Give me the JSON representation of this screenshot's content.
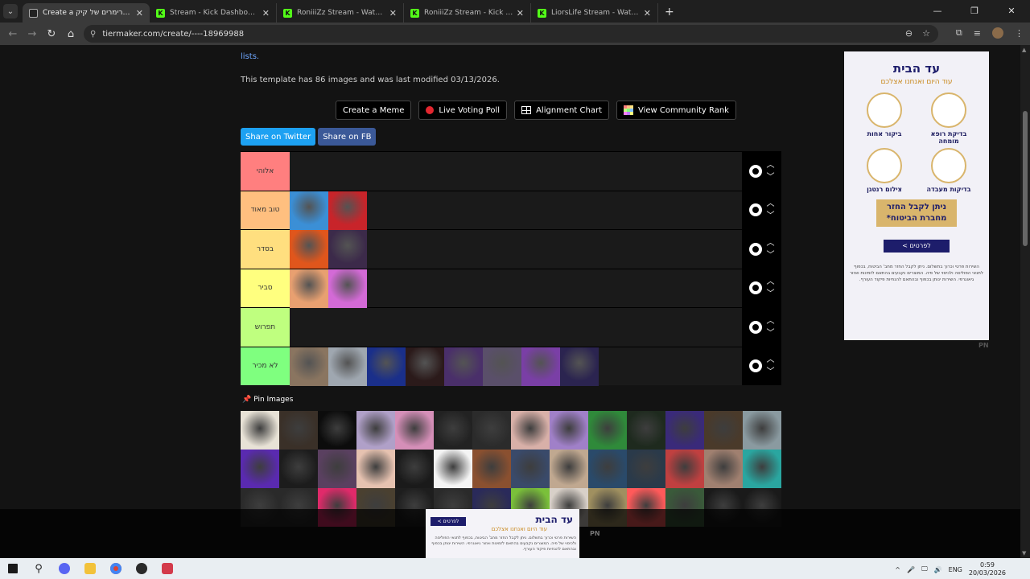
{
  "browser": {
    "tabs": [
      {
        "title": "Create a טירוג סטרימרים של קיק",
        "icon": "tiermaker-favicon",
        "active": true
      },
      {
        "title": "Stream - Kick Dashboard",
        "icon": "kick-favicon",
        "active": false
      },
      {
        "title": "RoniiiZz Stream - Watch Live on Kick",
        "icon": "kick-favicon",
        "active": false
      },
      {
        "title": "RoniiiZz Stream - Kick Dashboard",
        "icon": "kick-favicon",
        "active": false
      },
      {
        "title": "LiorsLife Stream - Watch Live on Kick",
        "icon": "kick-favicon",
        "active": false
      }
    ],
    "url": "tiermaker.com/create/----18969988"
  },
  "page": {
    "lists_link": "lists.",
    "template_info": "This template has 86 images and was last modified 03/13/2026.",
    "actions": {
      "create_meme": "Create a Meme",
      "live_voting": "Live Voting Poll",
      "alignment": "Alignment Chart",
      "community_rank": "View Community Rank"
    },
    "share": {
      "twitter": "Share on Twitter",
      "fb": "Share on FB"
    },
    "pin_images": "Pin Images",
    "tiers": [
      {
        "label": "אלוהי",
        "color": "#ff7f7f",
        "items": []
      },
      {
        "label": "טוב מאוד",
        "color": "#ffbf7f",
        "items": [
          "#3b8fd6",
          "#c8242a"
        ]
      },
      {
        "label": "בסדר",
        "color": "#ffdf7f",
        "items": [
          "#e0561c",
          "#3c2a4a"
        ]
      },
      {
        "label": "סביר",
        "color": "#ffff7f",
        "items": [
          "#e8a070",
          "#d36ad6"
        ]
      },
      {
        "label": "תפרוש",
        "color": "#bfff7f",
        "items": []
      },
      {
        "label": "לא מכיר",
        "color": "#7fff7f",
        "items": [
          "#8a7560",
          "#9fa7b0",
          "#1a2f8a",
          "#2b1a1a",
          "#4a2f6a",
          "#5a4f6a",
          "#7a3fa6",
          "#2b2450"
        ]
      }
    ],
    "pool_colors": [
      "#e8e2d6",
      "#3a3028",
      "#0c0c0c",
      "#b0a0c8",
      "#d58fb8",
      "#222222",
      "#2b2b2b",
      "#d8b0a8",
      "#a080c8",
      "#2f8a3a",
      "#1e2a1e",
      "#3a2a7a",
      "#4a3a2a",
      "#8a9aa0",
      "#5a2ab0",
      "#1c1c1c",
      "#5a4060",
      "#e6c2b0",
      "#1a1a1a",
      "#f4f4f4",
      "#8a5030",
      "#3a4a6a",
      "#c0a890",
      "#2a4a6a",
      "#2a3a4a",
      "#c04040",
      "#a08070",
      "#2aa6a0",
      "#2a2a2a",
      "#2a2a2a",
      "#e02a6a",
      "#4a4030",
      "#1e1e1e",
      "#2a2a2a",
      "#2a2a5a",
      "#7ac03a",
      "#d8d0c8",
      "#a09060",
      "#ff5a5a",
      "#3a5a3a",
      "#1a1a1a",
      "#1a1a1a"
    ]
  },
  "ad": {
    "brand": "עד הבית",
    "sub": "עוד היום ואנחנו אצלכם",
    "services": [
      "בדיקת רופא מומחה",
      "ביקור אחות",
      "בדיקות מעבדה",
      "צילום רנטגן"
    ],
    "gold": "ניתן לקבל החזר מחברת הביטוח*",
    "cta": "לפרטים >",
    "fine": "השירות פרטי וכרוך בתשלום. ניתן לקבל החזר מחב' הביטוח, בכפוף לתנאי הפוליסה ולכיסוי של פיה. המוצרים נקבעים בהתאם לזמינות ואזור גיאוגרפי. השירות ינותן בכפוף ובהתאם להנחיות פיקוד העורף.",
    "pn": "PN"
  },
  "ad_bottom": {
    "brand": "עד הבית",
    "sub": "עוד היום ואנחנו אצלכם",
    "cta": "לפרטים >",
    "fine": "השירות פרטי וכרוך בתשלום. ניתן לקבל החזר מחב' הביטוח, בכפוף לתנאי הפוליסה ולכיסוי של פיה. המוצרים נקבעים בהתאם לזמינות ואזור גיאוגרפי. השירות ינותן בכפוף ובהתאם להנחיות פיקוד העורף.",
    "pn": "PN"
  },
  "taskbar": {
    "lang": "ENG",
    "time": "0:59",
    "date": "20/03/2026"
  }
}
